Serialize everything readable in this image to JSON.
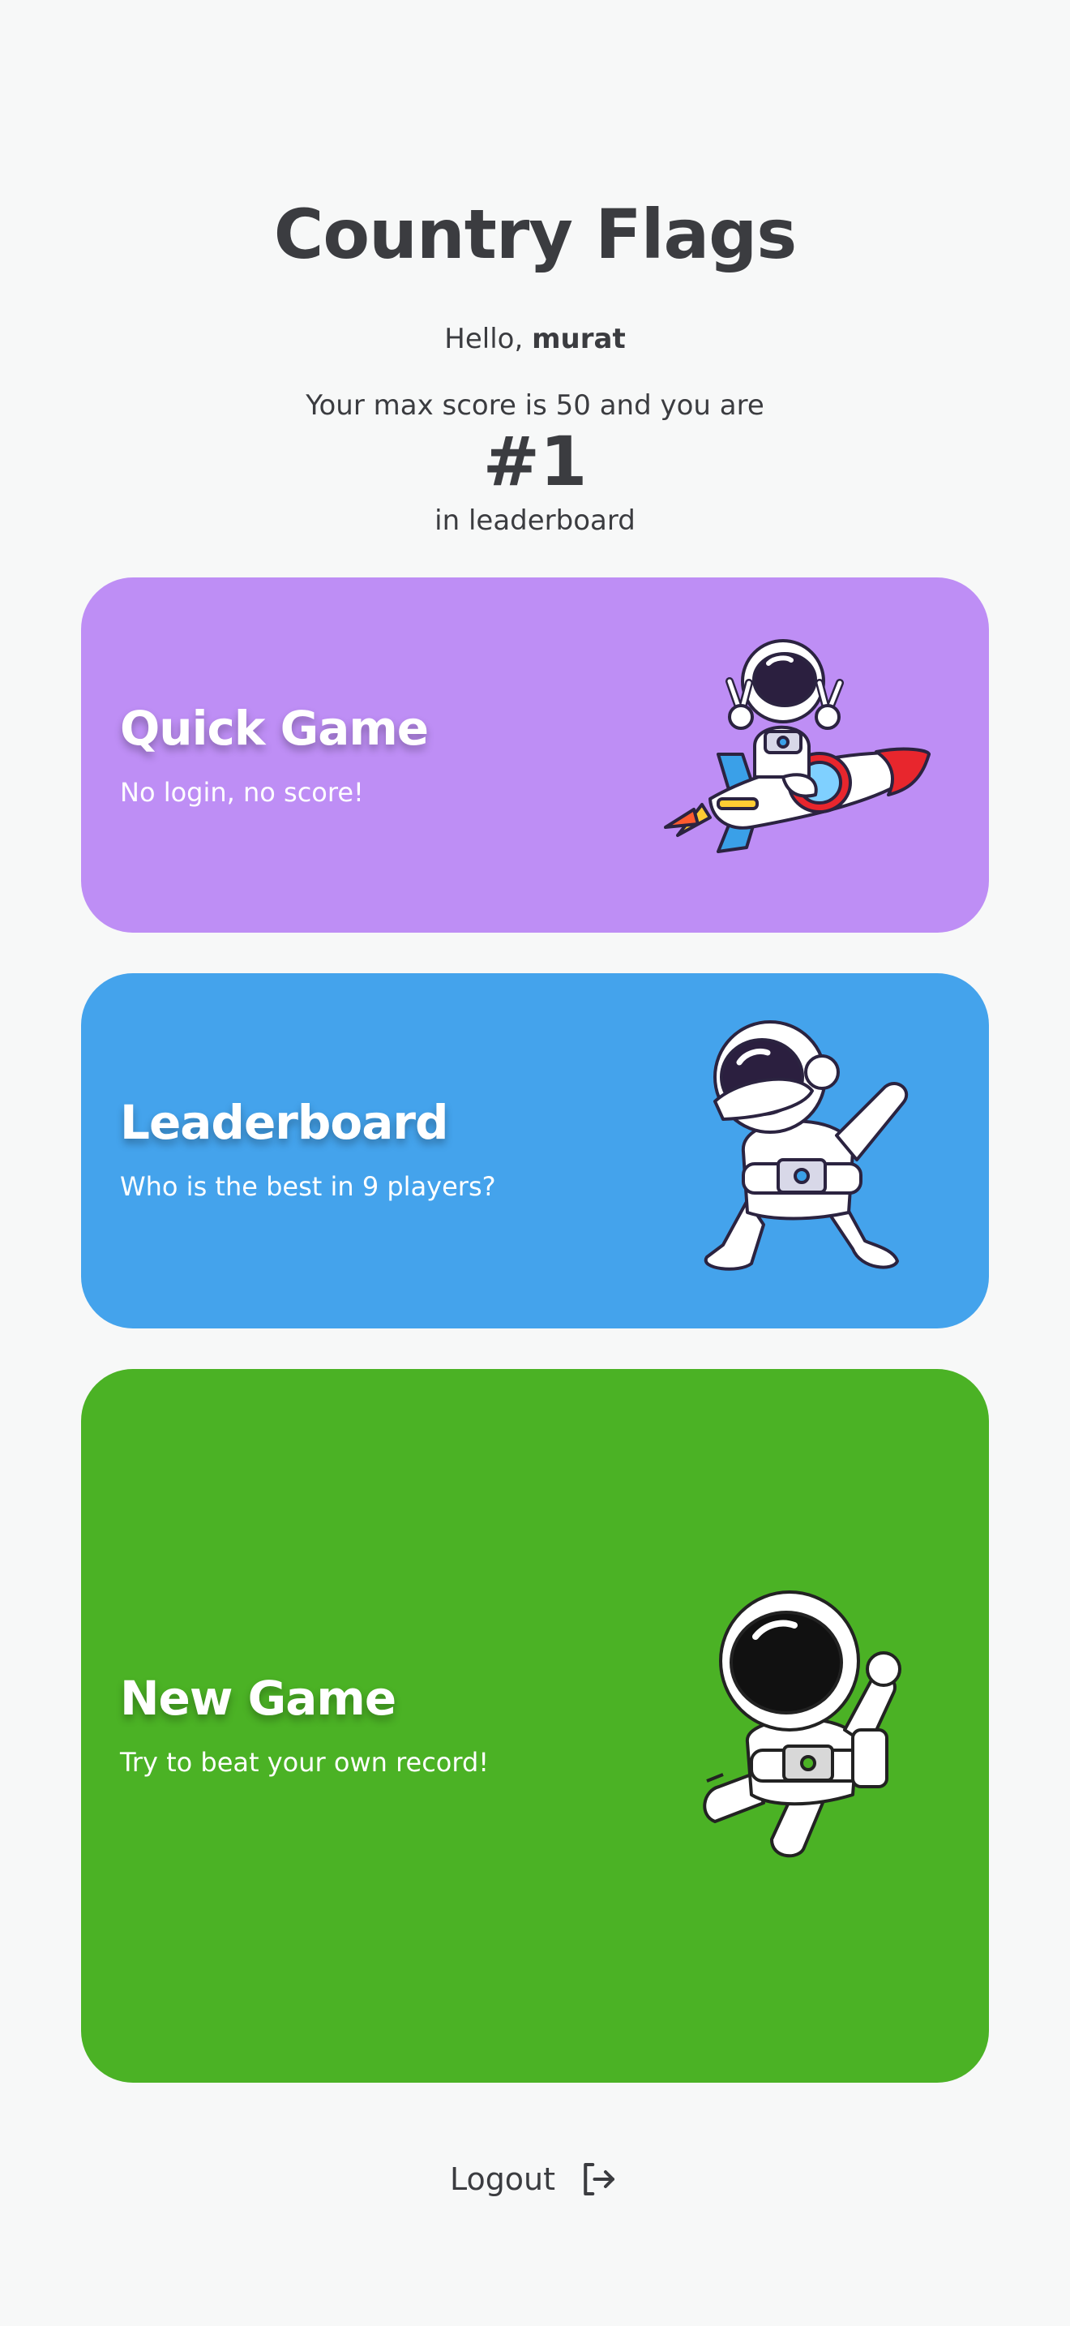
{
  "app": {
    "title": "Country Flags"
  },
  "greeting": {
    "prefix": "Hello,",
    "username": "murat"
  },
  "score": {
    "line": "Your max score is 50 and you are",
    "rank": "#1",
    "suffix": "in leaderboard"
  },
  "cards": [
    {
      "title": "Quick Game",
      "subtitle": "No login, no score!",
      "color": "#be8ef5",
      "icon": "astronaut-rocket-icon"
    },
    {
      "title": "Leaderboard",
      "subtitle": "Who is the best in 9 players?",
      "color": "#44a3ec",
      "icon": "astronaut-dab-icon"
    },
    {
      "title": "New Game",
      "subtitle": "Try to beat your own record!",
      "color": "#4bb225",
      "icon": "astronaut-jump-icon"
    }
  ],
  "logout": {
    "label": "Logout",
    "icon": "logout-icon"
  },
  "colors": {
    "background": "#f7f8f8",
    "text": "#3b3c40"
  }
}
